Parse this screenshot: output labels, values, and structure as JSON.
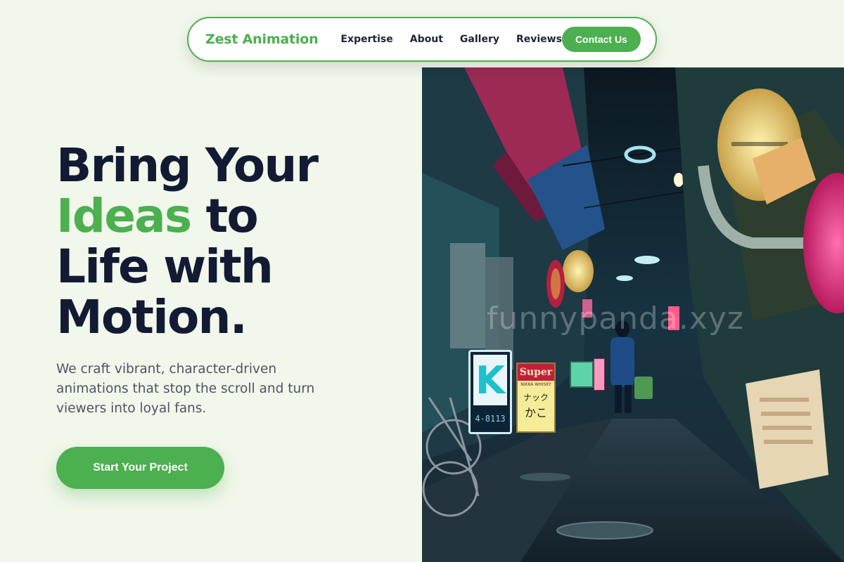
{
  "nav": {
    "brand": "Zest Animation",
    "links": [
      "Expertise",
      "About",
      "Gallery",
      "Reviews"
    ],
    "contact_label": "Contact Us"
  },
  "hero": {
    "title_line1": "Bring Your",
    "title_accent": "Ideas",
    "title_line2_rest": " to",
    "title_line3": "Life with",
    "title_line4": "Motion.",
    "subtitle": "We craft vibrant, character-driven animations that stop the scroll and turn viewers into loyal fans.",
    "cta_label": "Start Your Project"
  },
  "image": {
    "alt": "Neon-lit night alley with lanterns, shop signs and parked bicycles",
    "watermark": "funnypanda.xyz",
    "signs": {
      "k_sign_phone": "4-8113",
      "super_sign": "Super",
      "super_sub": "NIKKA WHISKY",
      "snack_sign": "ナック",
      "snack_sign2": "かこ"
    }
  },
  "colors": {
    "accent": "#4caf50",
    "heading": "#131a33",
    "body_text": "#4c5463",
    "page_bg": "#f1f7ea"
  }
}
